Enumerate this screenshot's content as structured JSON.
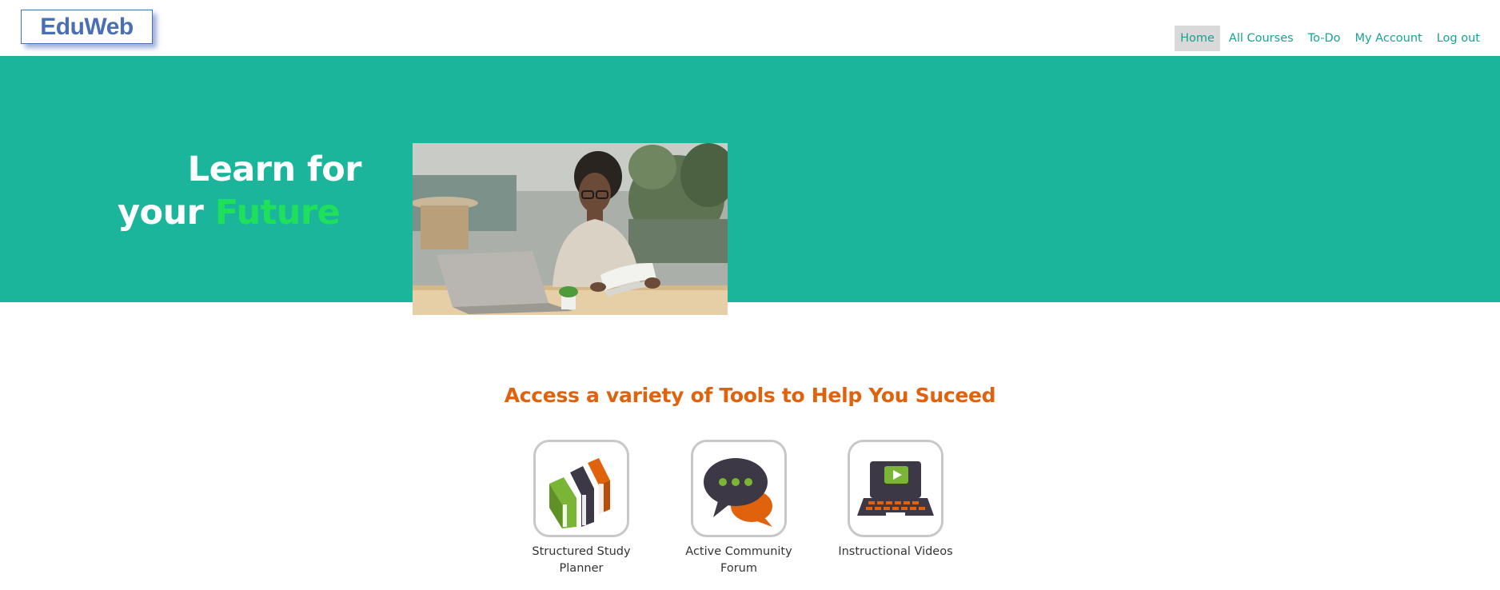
{
  "brand": {
    "logo_text": "EduWeb"
  },
  "nav": {
    "items": [
      {
        "label": "Home",
        "active": true
      },
      {
        "label": "All Courses",
        "active": false
      },
      {
        "label": "To-Do",
        "active": false
      },
      {
        "label": "My Account",
        "active": false
      },
      {
        "label": "Log out",
        "active": false
      }
    ]
  },
  "hero": {
    "title_line1": "Learn for",
    "title_line2_prefix": "your ",
    "title_line2_accent": "Future"
  },
  "tools": {
    "heading": "Access a variety of Tools to Help You Suceed",
    "items": [
      {
        "label": "Structured Study Planner",
        "icon": "books-icon"
      },
      {
        "label": "Active Community Forum",
        "icon": "chat-bubbles-icon"
      },
      {
        "label": "Instructional Videos",
        "icon": "laptop-video-icon"
      }
    ]
  },
  "colors": {
    "accent_teal": "#1ab59a",
    "nav_text": "#1aa191",
    "heading_orange": "#e0620d",
    "hero_accent_green": "#1ee05a",
    "logo_blue": "#4a6fb5"
  }
}
